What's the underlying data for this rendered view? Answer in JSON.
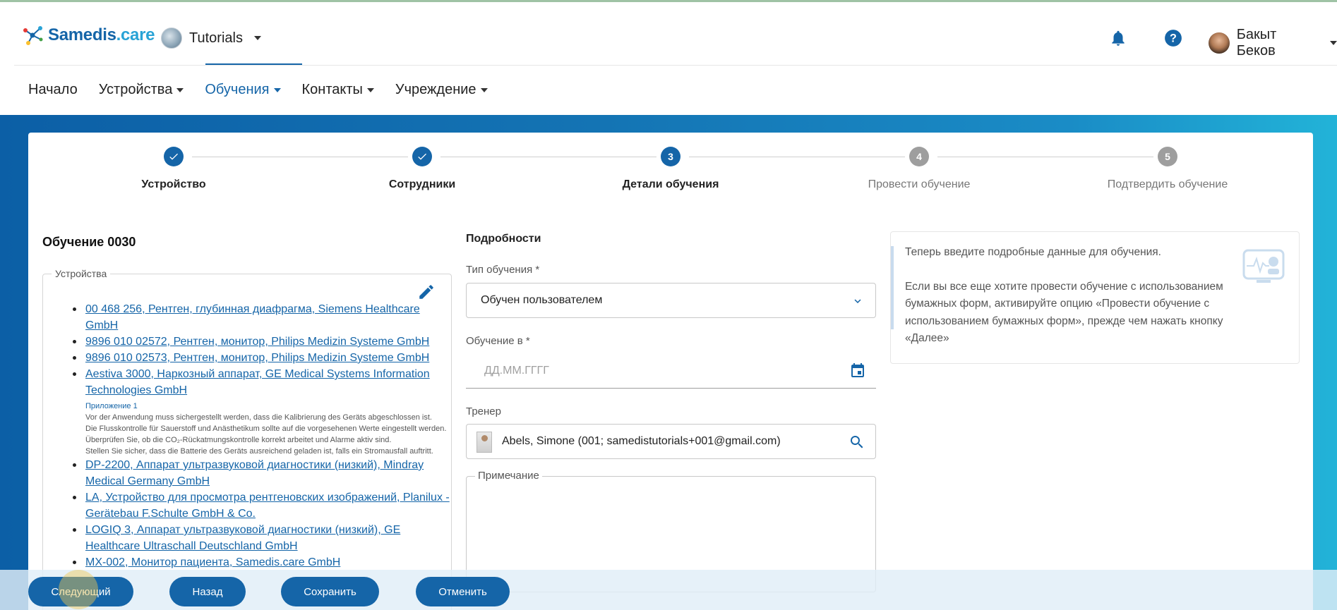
{
  "header": {
    "logo_text_main": "Samedis",
    "logo_text_suffix": ".care",
    "org_name": "Tutorials",
    "user_name": "Бакыт Беков",
    "bell_icon": "bell-icon",
    "help_icon": "help-icon"
  },
  "nav": {
    "items": [
      {
        "label": "Начало",
        "has_dropdown": false,
        "active": false
      },
      {
        "label": "Устройства",
        "has_dropdown": true,
        "active": false
      },
      {
        "label": "Обучения",
        "has_dropdown": true,
        "active": true
      },
      {
        "label": "Контакты",
        "has_dropdown": true,
        "active": false
      },
      {
        "label": "Учреждение",
        "has_dropdown": true,
        "active": false
      }
    ]
  },
  "stepper": {
    "steps": [
      {
        "number": "1",
        "label": "Устройство",
        "state": "done"
      },
      {
        "number": "2",
        "label": "Сотрудники",
        "state": "done"
      },
      {
        "number": "3",
        "label": "Детали обучения",
        "state": "current"
      },
      {
        "number": "4",
        "label": "Провести обучение",
        "state": "todo"
      },
      {
        "number": "5",
        "label": "Подтвердить обучение",
        "state": "todo"
      }
    ]
  },
  "left": {
    "title": "Обучение 0030",
    "devices_legend": "Устройства",
    "devices": [
      {
        "label": "00 468 256, Рентген, глубинная диафрагма, Siemens Healthcare GmbH"
      },
      {
        "label": "9896 010 02572, Рентген, монитор, Philips Medizin Systeme GmbH"
      },
      {
        "label": "9896 010 02573, Рентген, монитор, Philips Medizin Systeme GmbH"
      },
      {
        "label": "Aestiva 3000, Наркозный аппарат, GE Medical Systems Information Technologies GmbH",
        "attachment_title": "Приложение 1",
        "attachment_text": "Vor der Anwendung muss sichergestellt werden, dass die Kalibrierung des Geräts abgeschlossen ist.\nDie Flusskontrolle für Sauerstoff und Anästhetikum sollte auf die vorgesehenen Werte eingestellt werden.\nÜberprüfen Sie, ob die CO₂-Rückatmungskontrolle korrekt arbeitet und Alarme aktiv sind.\nStellen Sie sicher, dass die Batterie des Geräts ausreichend geladen ist, falls ein Stromausfall auftritt."
      },
      {
        "label": "DP-2200, Аппарат ультразвуковой диагностики (низкий), Mindray Medical Germany GmbH"
      },
      {
        "label": "LA, Устройство для просмотра рентгеновских изображений, Planilux - Gerätebau F.Schulte GmbH & Co."
      },
      {
        "label": "LOGIQ 3, Аппарат ультразвуковой диагностики (низкий), GE Healthcare Ultraschall Deutschland GmbH"
      },
      {
        "label": "MX-002, Монитор пациента, Samedis.care GmbH"
      }
    ]
  },
  "details": {
    "section_title": "Подробности",
    "type_label": "Тип обучения *",
    "type_value": "Обучен пользователем",
    "date_label": "Обучение в *",
    "date_placeholder": "ДД.ММ.ГГГГ",
    "trainer_label": "Тренер",
    "trainer_value": "Abels, Simone (001; samedistutorials+001@gmail.com)",
    "note_label": "Примечание"
  },
  "info": {
    "line1": "Теперь введите подробные данные для обучения.",
    "line2": "Если вы все еще хотите провести обучение с использованием бумажных форм, активируйте опцию «Провести обучение с использованием бумажных форм», прежде чем нажать кнопку «Далее»"
  },
  "actions": {
    "next": "Следующий",
    "back": "Назад",
    "save": "Сохранить",
    "cancel": "Отменить"
  },
  "colors": {
    "primary": "#1565a8",
    "step_todo": "#9e9e9e",
    "link": "#1565a8"
  }
}
